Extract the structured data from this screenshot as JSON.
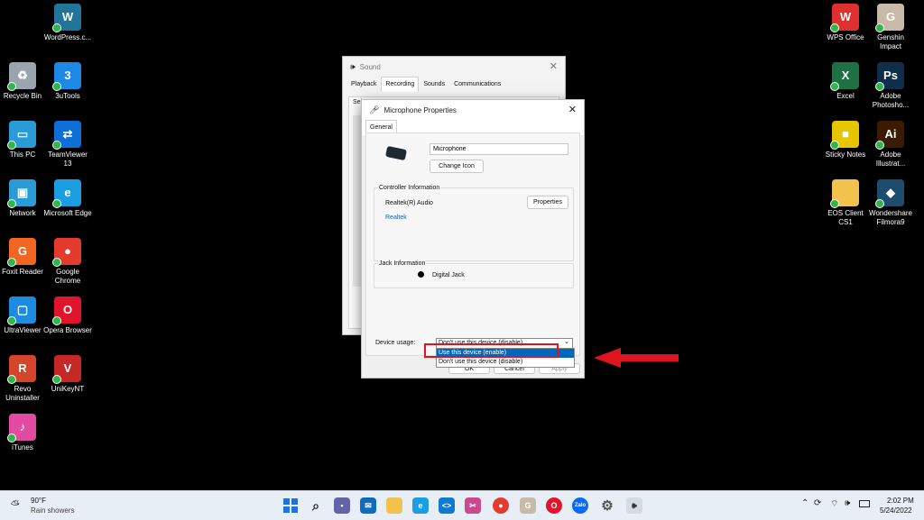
{
  "desktop_left": [
    {
      "label": "WordPress.c...",
      "icon": "wordpress-icon",
      "glyph": "W",
      "color": "#21759b"
    },
    {
      "label": "Recycle Bin",
      "icon": "recycle-bin-icon",
      "glyph": "♻",
      "color": "#9aa4ad"
    },
    {
      "label": "3uTools",
      "icon": "3utools-icon",
      "glyph": "3",
      "color": "#1e88e5"
    },
    {
      "label": "This PC",
      "icon": "this-pc-icon",
      "glyph": "▭",
      "color": "#2a9bd7"
    },
    {
      "label": "TeamViewer 13",
      "icon": "teamviewer-icon",
      "glyph": "⇄",
      "color": "#0e6fd6"
    },
    {
      "label": "Network",
      "icon": "network-icon",
      "glyph": "▣",
      "color": "#2a9bd7"
    },
    {
      "label": "Microsoft Edge",
      "icon": "edge-icon",
      "glyph": "e",
      "color": "#1b9de2"
    },
    {
      "label": "Foxit Reader",
      "icon": "foxit-icon",
      "glyph": "G",
      "color": "#f26522"
    },
    {
      "label": "Google Chrome",
      "icon": "chrome-icon",
      "glyph": "●",
      "color": "#e33b2e"
    },
    {
      "label": "UltraViewer",
      "icon": "ultraviewer-icon",
      "glyph": "▢",
      "color": "#1d8ce0"
    },
    {
      "label": "Opera Browser",
      "icon": "opera-icon",
      "glyph": "O",
      "color": "#e0152b"
    },
    {
      "label": "Revo Uninstaller",
      "icon": "revo-icon",
      "glyph": "R",
      "color": "#d4452c"
    },
    {
      "label": "UniKeyNT",
      "icon": "unikey-icon",
      "glyph": "V",
      "color": "#c62828"
    },
    {
      "label": "iTunes",
      "icon": "itunes-icon",
      "glyph": "♪",
      "color": "#e24ba1"
    }
  ],
  "desktop_right": [
    {
      "label": "WPS Office",
      "icon": "wps-office-icon",
      "glyph": "W",
      "color": "#e02f2f"
    },
    {
      "label": "Genshin Impact",
      "icon": "genshin-icon",
      "glyph": "G",
      "color": "#c9b9a8"
    },
    {
      "label": "Excel",
      "icon": "excel-icon",
      "glyph": "X",
      "color": "#1e7145"
    },
    {
      "label": "Adobe Photosho...",
      "icon": "photoshop-icon",
      "glyph": "Ps",
      "color": "#0f2e4a"
    },
    {
      "label": "Sticky Notes",
      "icon": "sticky-notes-icon",
      "glyph": "■",
      "color": "#e5c600"
    },
    {
      "label": "Adobe Illustrat...",
      "icon": "illustrator-icon",
      "glyph": "Ai",
      "color": "#3a1b00"
    },
    {
      "label": "EOS Client CS1",
      "icon": "folder-icon",
      "glyph": "",
      "color": "#f2c14e"
    },
    {
      "label": "Wondershare Filmora9",
      "icon": "filmora-icon",
      "glyph": "◆",
      "color": "#1d4c6e"
    }
  ],
  "sound_window": {
    "title": "Sound",
    "tabs": [
      "Playback",
      "Recording",
      "Sounds",
      "Communications"
    ],
    "partial_text": "Sel"
  },
  "mic_dialog": {
    "title": "Microphone Properties",
    "tab": "General",
    "name_value": "Microphone",
    "change_icon": "Change Icon",
    "controller_header": "Controller Information",
    "controller_name": "Realtek(R) Audio",
    "properties_btn": "Properties",
    "controller_link": "Realtek",
    "jack_header": "Jack Information",
    "jack_name": "Digital Jack",
    "device_usage_label": "Device usage:",
    "device_usage_value": "Don't use this device (disable)",
    "dropdown_options": [
      "Use this device (enable)",
      "Don't use this device (disable)"
    ],
    "ok": "OK",
    "cancel": "Cancel",
    "apply": "Apply"
  },
  "taskbar": {
    "temperature": "90°F",
    "weather": "Rain showers",
    "time": "2:02 PM",
    "date": "5/24/2022"
  },
  "colors": {
    "accent": "#0067c0",
    "annotation": "#e0141e"
  }
}
